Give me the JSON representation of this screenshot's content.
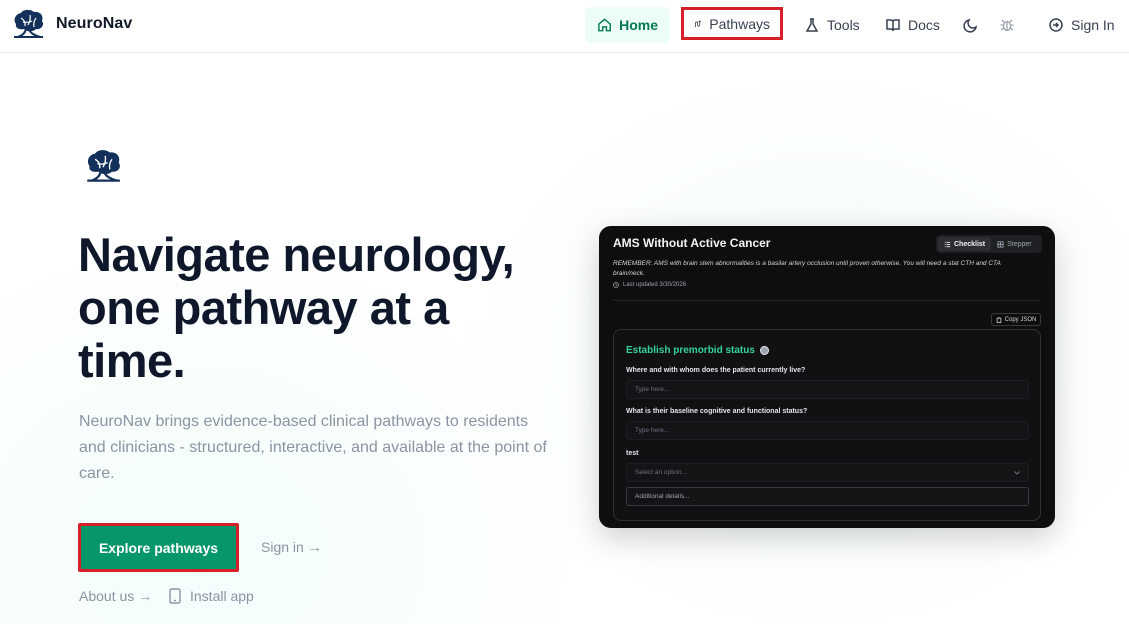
{
  "brand": {
    "name": "NeuroNav"
  },
  "nav": {
    "home": "Home",
    "pathways": "Pathways",
    "tools": "Tools",
    "docs": "Docs",
    "sign_in": "Sign In",
    "icons": [
      "home-icon",
      "pathways-icon",
      "flask-icon",
      "book-icon",
      "moon-icon",
      "bug-icon",
      "sign-in-icon"
    ]
  },
  "hero": {
    "title": "Navigate neurology, one pathway at a time.",
    "description": "NeuroNav brings evidence-based clinical pathways to residents and clinicians - structured, interactive, and available at the point of care.",
    "explore_button": "Explore pathways",
    "sign_in_link": "Sign in →",
    "about_link": "About us →",
    "install_link": "Install app"
  },
  "preview": {
    "title": "AMS Without Active Cancer",
    "toggle": {
      "checklist": "Checklist",
      "stepper": "Stepper"
    },
    "remember": "REMEMBER: AMS with brain stem abnormalities is a basilar artery occlusion until proven otherwise. You will need a stat CTH and CTA brain/neck.",
    "last_updated": "Last updated 3/30/2026",
    "copy_json": "Copy JSON",
    "section_title": "Establish premorbid status",
    "questions": [
      {
        "label": "Where and with whom does the patient currently live?",
        "placeholder": "Type here..."
      },
      {
        "label": "What is their baseline cognitive and functional status?",
        "placeholder": "Type here..."
      },
      {
        "label": "test",
        "placeholder": "Select an option..."
      }
    ],
    "additional_details": "Additional details..."
  },
  "colors": {
    "accent": "#059669",
    "accent_light": "#ecfdf5",
    "highlight_box": "#d61f26",
    "brand_navy": "#12305a"
  }
}
